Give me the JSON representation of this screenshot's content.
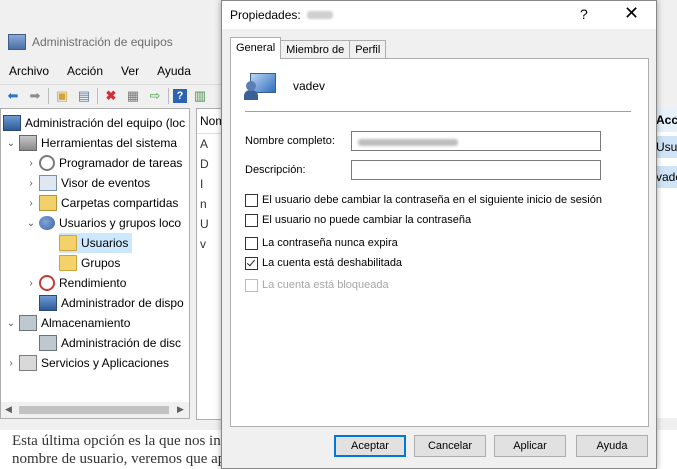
{
  "mmc": {
    "title": "Administración de equipos",
    "menu": [
      "Archivo",
      "Acción",
      "Ver",
      "Ayuda"
    ],
    "tree": {
      "root": "Administración del equipo (loc",
      "system_tools": "Herramientas del sistema",
      "task_scheduler": "Programador de tareas",
      "event_viewer": "Visor de eventos",
      "shared_folders": "Carpetas compartidas",
      "local_users": "Usuarios y grupos loco",
      "users": "Usuarios",
      "groups": "Grupos",
      "performance": "Rendimiento",
      "device_manager": "Administrador de dispo",
      "storage": "Almacenamiento",
      "disk_management": "Administración de disc",
      "services": "Servicios y Aplicaciones"
    },
    "list": {
      "header": "Nom",
      "rows": [
        "A",
        "D",
        "I",
        "n",
        "U",
        "v"
      ]
    },
    "actions": {
      "header": "Acci",
      "row1": "Usua",
      "row2": "vadev"
    }
  },
  "doc_text": {
    "line1": "Esta última opción es la que nos in",
    "line2": "nombre de usuario, veremos que aparece el icono"
  },
  "dialog": {
    "title": "Propiedades:",
    "help_glyph": "?",
    "close_glyph": "✕",
    "tabs": [
      "General",
      "Miembro de",
      "Perfil"
    ],
    "user_name": "vadev",
    "full_name_label": "Nombre completo:",
    "description_label": "Descripción:",
    "description_value": "",
    "checkboxes": [
      {
        "label": "El usuario debe cambiar la contraseña en el siguiente inicio de sesión",
        "checked": false,
        "enabled": true
      },
      {
        "label": "El usuario no puede cambiar la contraseña",
        "checked": false,
        "enabled": true
      },
      {
        "label": "La contraseña nunca expira",
        "checked": false,
        "enabled": true
      },
      {
        "label": "La cuenta está deshabilitada",
        "checked": true,
        "enabled": true
      },
      {
        "label": "La cuenta está bloqueada",
        "checked": false,
        "enabled": false
      }
    ],
    "buttons": {
      "ok": "Aceptar",
      "cancel": "Cancelar",
      "apply": "Aplicar",
      "help": "Ayuda"
    }
  }
}
